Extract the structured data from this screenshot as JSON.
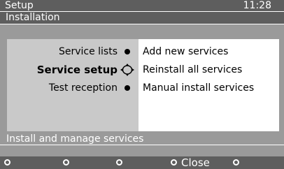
{
  "header": {
    "title": "Setup",
    "time": "11:28"
  },
  "section": {
    "title": "Installation"
  },
  "menu": {
    "items": [
      {
        "label": "Service lists",
        "active": false
      },
      {
        "label": "Service setup",
        "active": true
      },
      {
        "label": "Test reception",
        "active": false
      }
    ]
  },
  "options": [
    {
      "label": "Add new services"
    },
    {
      "label": "Reinstall all services"
    },
    {
      "label": "Manual install services"
    }
  ],
  "footer": {
    "hint": "Install and manage services",
    "softkeys": [
      {
        "label": ""
      },
      {
        "label": ""
      },
      {
        "label": ""
      },
      {
        "label": "Close"
      },
      {
        "label": ""
      }
    ]
  },
  "colors": {
    "background": "#9a9a9a",
    "header_bar": "#5e5e5e",
    "menu_panel": "#c9c9c9",
    "options_panel": "#ffffff",
    "text_light": "#ffffff"
  },
  "icons": {
    "menu_bullet": "filled-circle-icon",
    "active_indicator": "navigation-pad-icon",
    "softkey": "circle-icon"
  }
}
